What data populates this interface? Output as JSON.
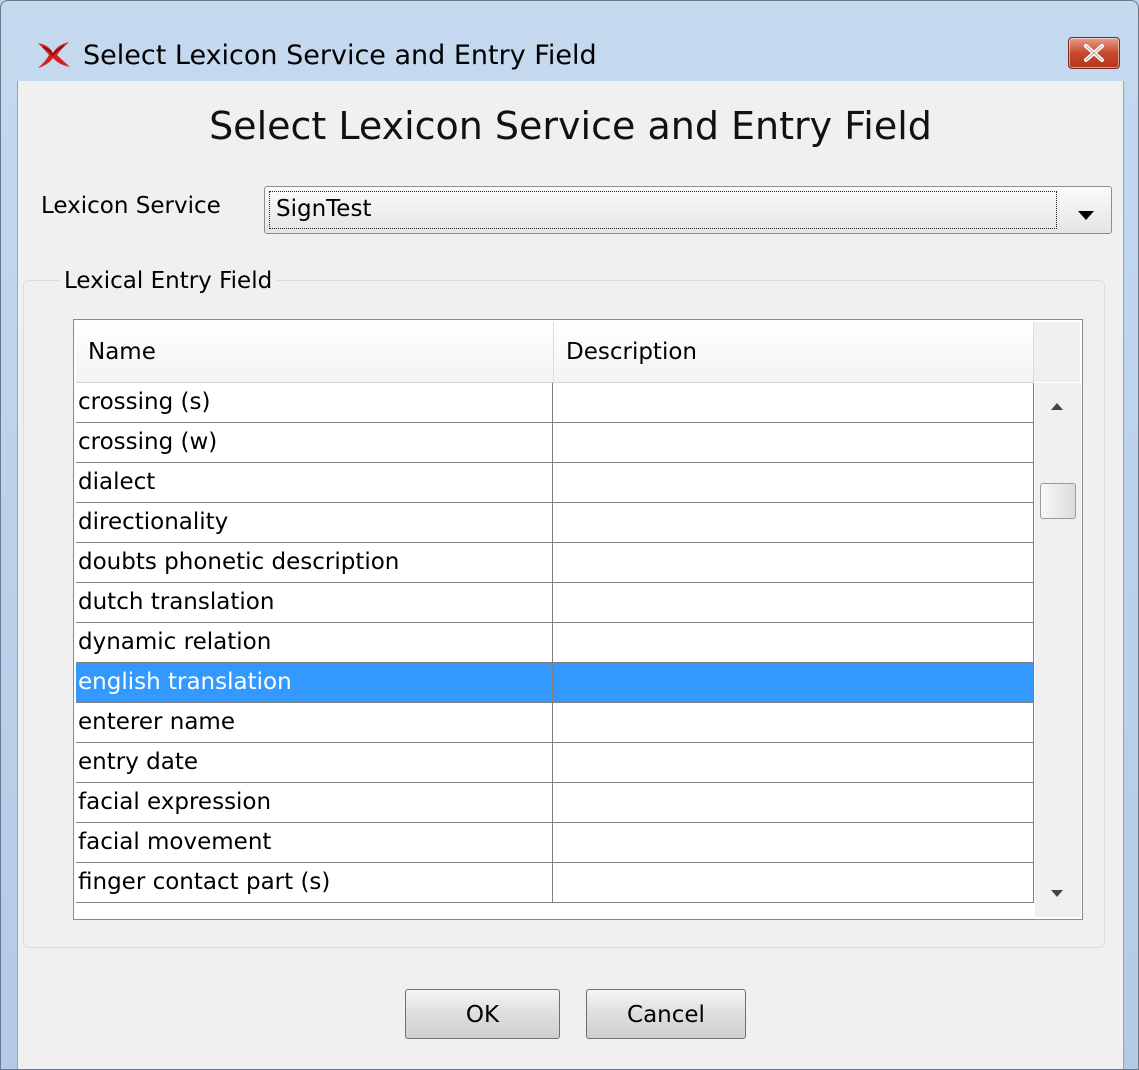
{
  "window": {
    "title": "Select Lexicon Service and Entry Field",
    "close_label": "×"
  },
  "dialog": {
    "heading": "Select Lexicon Service and Entry Field",
    "lexicon_service_label": "Lexicon Service",
    "lexicon_service_value": "SignTest",
    "group_title": "Lexical Entry Field"
  },
  "table": {
    "columns": [
      "Name",
      "Description"
    ],
    "rows": [
      {
        "name": "crossing (s)",
        "description": ""
      },
      {
        "name": "crossing (w)",
        "description": ""
      },
      {
        "name": "dialect",
        "description": ""
      },
      {
        "name": "directionality",
        "description": ""
      },
      {
        "name": "doubts phonetic description",
        "description": ""
      },
      {
        "name": "dutch translation",
        "description": ""
      },
      {
        "name": "dynamic relation",
        "description": ""
      },
      {
        "name": "english translation",
        "description": ""
      },
      {
        "name": "enterer name",
        "description": ""
      },
      {
        "name": "entry date",
        "description": ""
      },
      {
        "name": "facial expression",
        "description": ""
      },
      {
        "name": "facial movement",
        "description": ""
      },
      {
        "name": "finger contact part (s)",
        "description": ""
      }
    ],
    "selected_row": "english translation"
  },
  "buttons": {
    "ok": "OK",
    "cancel": "Cancel"
  },
  "colors": {
    "selection": "#3399ff",
    "close_button": "#c8482e",
    "title_background": "#b9d1ea"
  },
  "icons": {
    "app": "app-logo-icon",
    "close": "close-icon",
    "dropdown": "chevron-down-icon",
    "scroll_up": "scroll-up-arrow-icon",
    "scroll_down": "scroll-down-arrow-icon"
  }
}
